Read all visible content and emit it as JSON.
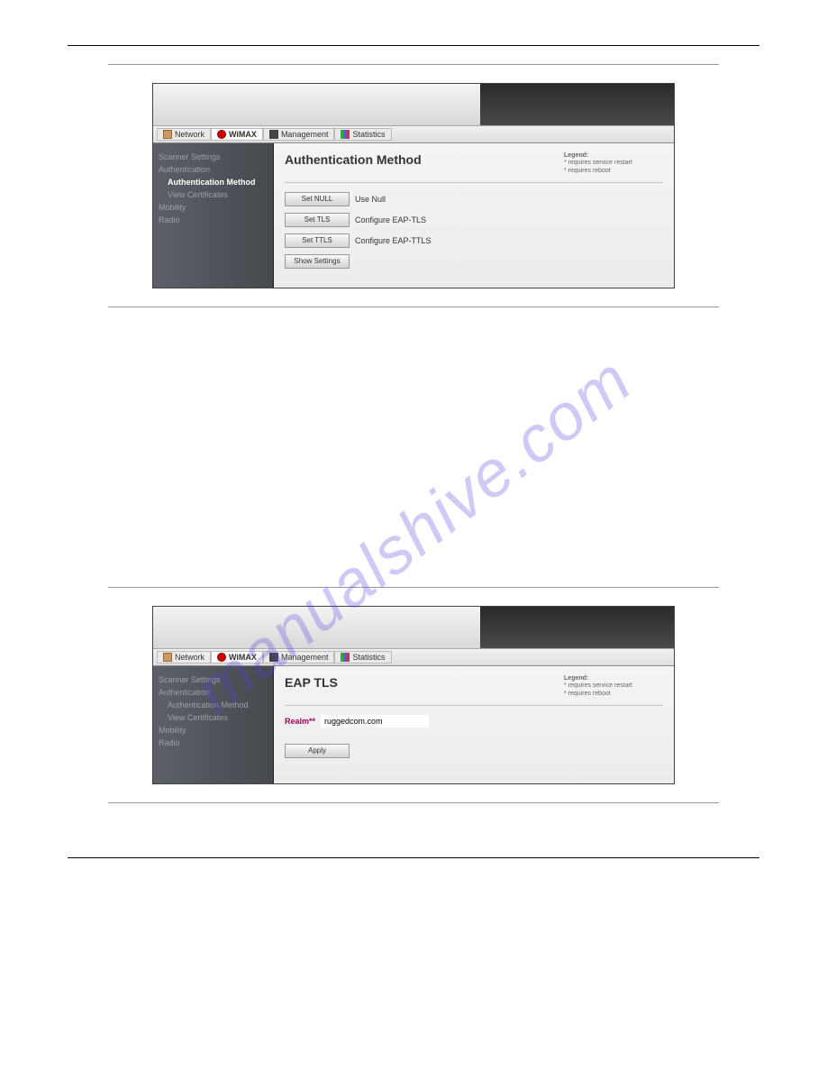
{
  "nav": {
    "network": "Network",
    "wimax": "WiMAX",
    "management": "Management",
    "statistics": "Statistics"
  },
  "sidebar": {
    "scanner": "Scanner Settings",
    "auth": "Authentication",
    "auth_method": "Authentication Method",
    "view_cert": "View Certificates",
    "mobility": "Mobility",
    "radio": "Radio"
  },
  "legend": {
    "title": "Legend:",
    "line1": "* requires service restart",
    "line2": "* requires reboot"
  },
  "fig1": {
    "title": "Authentication Method",
    "btn_null": "Set NULL",
    "lbl_null": "Use Null",
    "btn_tls": "Set TLS",
    "lbl_tls": "Configure EAP-TLS",
    "btn_ttls": "Set TTLS",
    "lbl_ttls": "Configure EAP-TTLS",
    "btn_show": "Show Settings"
  },
  "fig2": {
    "title": "EAP TLS",
    "realm_label": "Realm**",
    "realm_value": "ruggedcom.com",
    "btn_apply": "Apply"
  },
  "watermark": "manualshive.com"
}
